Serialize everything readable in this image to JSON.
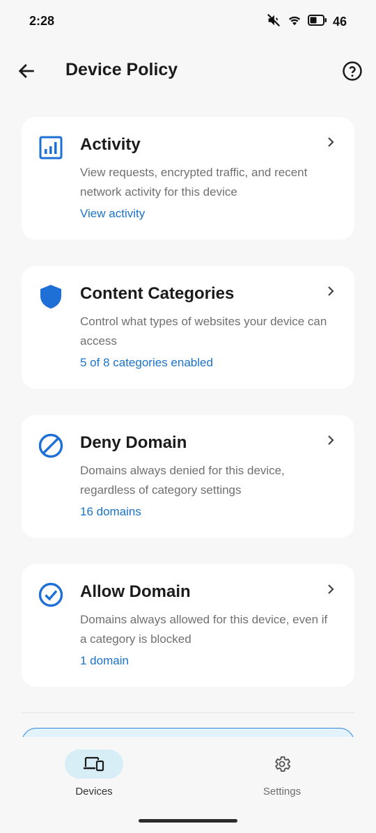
{
  "status_bar": {
    "time": "2:28",
    "battery": "46",
    "icons": [
      "mute-icon",
      "wifi-icon",
      "battery-icon"
    ]
  },
  "header": {
    "title": "Device Policy",
    "back_icon": "arrow-left-icon",
    "help_icon": "help-circle-icon"
  },
  "cards": [
    {
      "title": "Activity",
      "description": "View requests, encrypted traffic, and recent network activity for this device",
      "link": "View activity",
      "icon": "activity-chart-icon"
    },
    {
      "title": "Content Categories",
      "description": "Control what types of websites your device can access",
      "link": "5 of 8 categories enabled",
      "icon": "shield-icon"
    },
    {
      "title": "Deny Domain",
      "description": "Domains always denied for this device, regardless of category settings",
      "link": "16 domains",
      "icon": "block-icon"
    },
    {
      "title": "Allow Domain",
      "description": "Domains always allowed for this device, even if a category is blocked",
      "link": "1 domain",
      "icon": "check-circle-icon"
    }
  ],
  "bottom_nav": {
    "items": [
      {
        "label": "Devices",
        "icon": "devices-icon",
        "active": true
      },
      {
        "label": "Settings",
        "icon": "gear-icon",
        "active": false
      }
    ]
  },
  "colors": {
    "accent": "#1a73c9",
    "icon_blue": "#1e6fd6",
    "active_pill": "#d8eef7",
    "background": "#f7f7f7"
  }
}
